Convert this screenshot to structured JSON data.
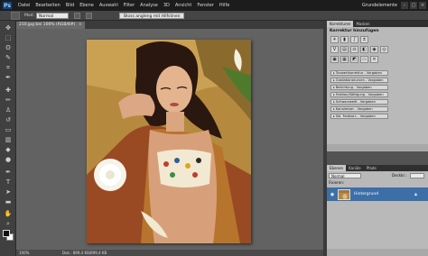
{
  "app": {
    "logo": "Ps",
    "menu": [
      "Datei",
      "Bearbeiten",
      "Bild",
      "Ebene",
      "Auswahl",
      "Filter",
      "Analyse",
      "3D",
      "Ansicht",
      "Fenster",
      "Hilfe"
    ],
    "workspace": "Grundelemente"
  },
  "options": {
    "mode_label": "Mod:",
    "mode_value": "Normal",
    "button_label": "Bloss angleng mit Hilfslinen"
  },
  "document": {
    "tab_title": "210.jpg bei 100% (RGB/8#)",
    "close": "×",
    "zoom": "100%",
    "doc_info": "Dok.: 899,4 KB/899,4 KB"
  },
  "corrections": {
    "tabs": [
      "Korrekturen",
      "Masken"
    ],
    "title": "Korrektur hinzufügen",
    "presets": [
      "Tonwertkorrektur - Vorgaben",
      "Gradationskurven - Vorgaben",
      "Belichtung - Vorgaben",
      "Farbton/Sättigung - Vorgaben",
      "Schwarzweiß - Vorgaben",
      "Kanalmixer - Vorgaben",
      "Sel. Farbkorr. - Vorgaben"
    ]
  },
  "layers": {
    "tabs": [
      "Ebenen",
      "Kanäle",
      "Pfade"
    ],
    "blend_mode": "Normal",
    "opacity_label": "Deckkr.:",
    "lock_label": "Fixieren:",
    "layer_name": "Hintergrund"
  },
  "colors": {
    "menubar": "#1c1c1c",
    "panel": "#b9b9b9",
    "selected_layer": "#3c6fa8"
  }
}
